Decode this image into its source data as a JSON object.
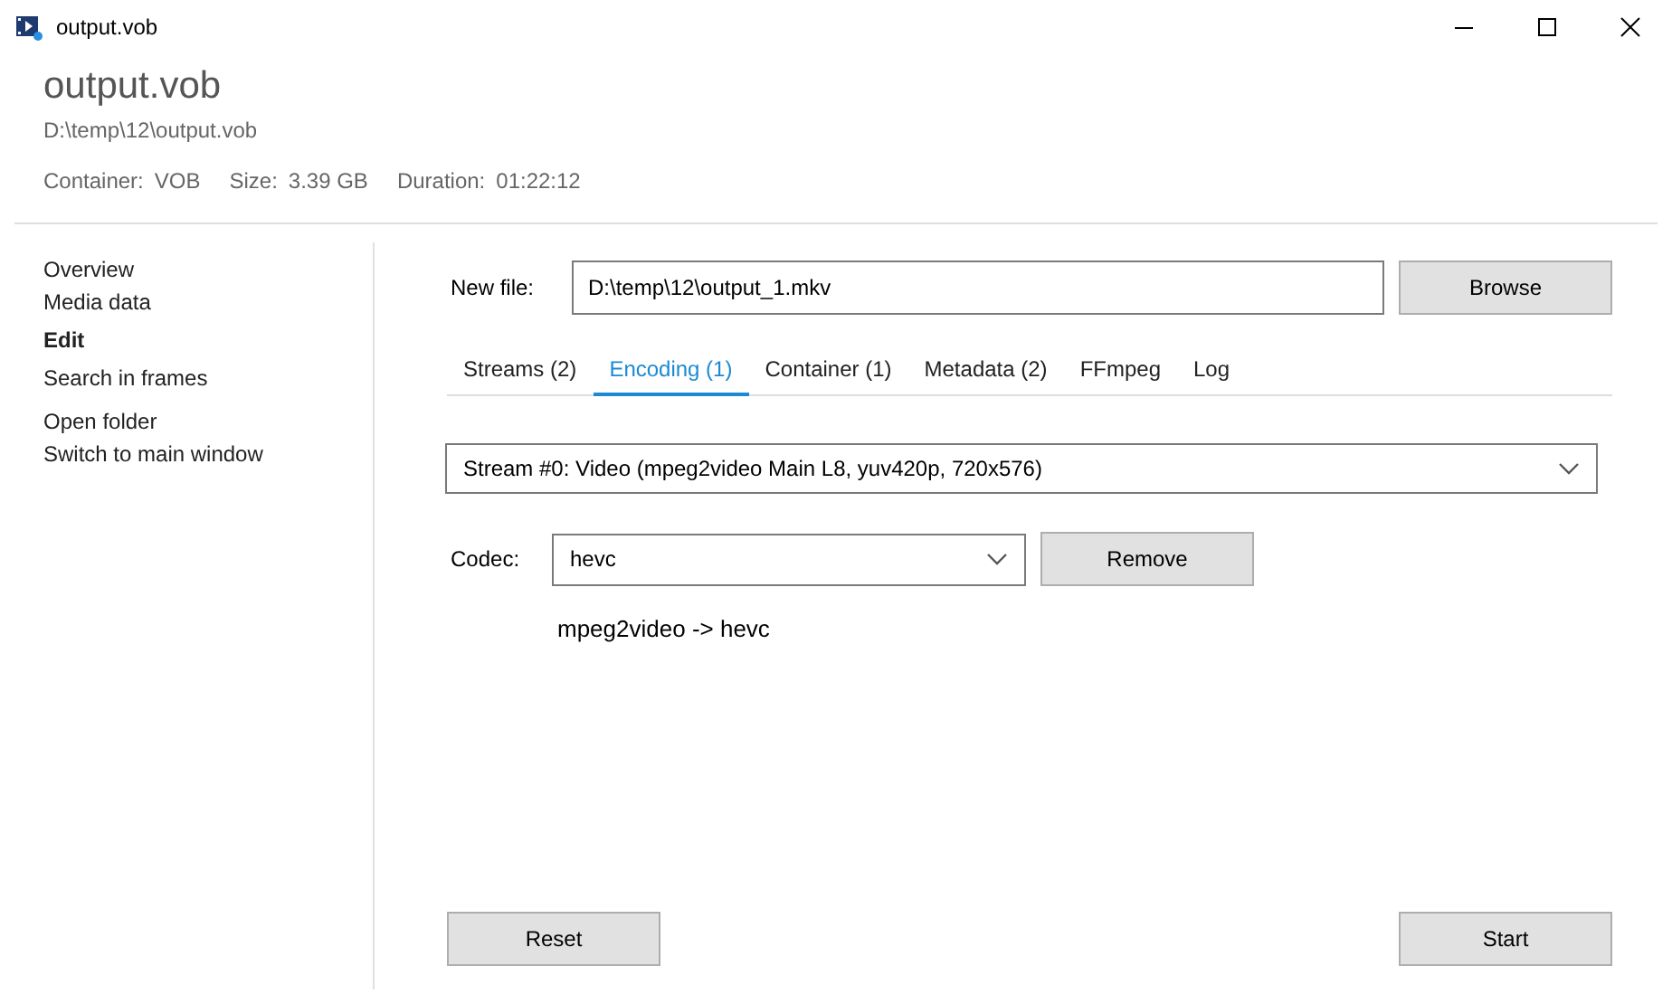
{
  "window": {
    "title": "output.vob"
  },
  "header": {
    "title": "output.vob",
    "path": "D:\\temp\\12\\output.vob",
    "info": [
      {
        "label": "Container:",
        "value": "VOB"
      },
      {
        "label": "Size:",
        "value": "3.39 GB"
      },
      {
        "label": "Duration:",
        "value": "01:22:12"
      }
    ]
  },
  "sidebar": {
    "groups": [
      [
        {
          "label": "Overview",
          "selected": false
        },
        {
          "label": "Media data",
          "selected": false
        },
        {
          "label": "Edit",
          "selected": true
        },
        {
          "label": "Search in frames",
          "selected": false
        }
      ],
      [
        {
          "label": "Open folder",
          "selected": false
        },
        {
          "label": "Switch to main window",
          "selected": false
        }
      ]
    ]
  },
  "new_file": {
    "label": "New file:",
    "value": "D:\\temp\\12\\output_1.mkv",
    "button": "Browse"
  },
  "tabs": [
    {
      "label": "Streams (2)",
      "selected": false
    },
    {
      "label": "Encoding (1)",
      "selected": true
    },
    {
      "label": "Container (1)",
      "selected": false
    },
    {
      "label": "Metadata (2)",
      "selected": false
    },
    {
      "label": "FFmpeg",
      "selected": false
    },
    {
      "label": "Log",
      "selected": false
    }
  ],
  "stream_select": {
    "value": "Stream #0: Video (mpeg2video Main L8, yuv420p, 720x576)"
  },
  "codec": {
    "label": "Codec:",
    "value": "hevc",
    "button": "Remove",
    "conversion": "mpeg2video -> hevc"
  },
  "buttons": {
    "reset": "Reset",
    "start": "Start"
  }
}
